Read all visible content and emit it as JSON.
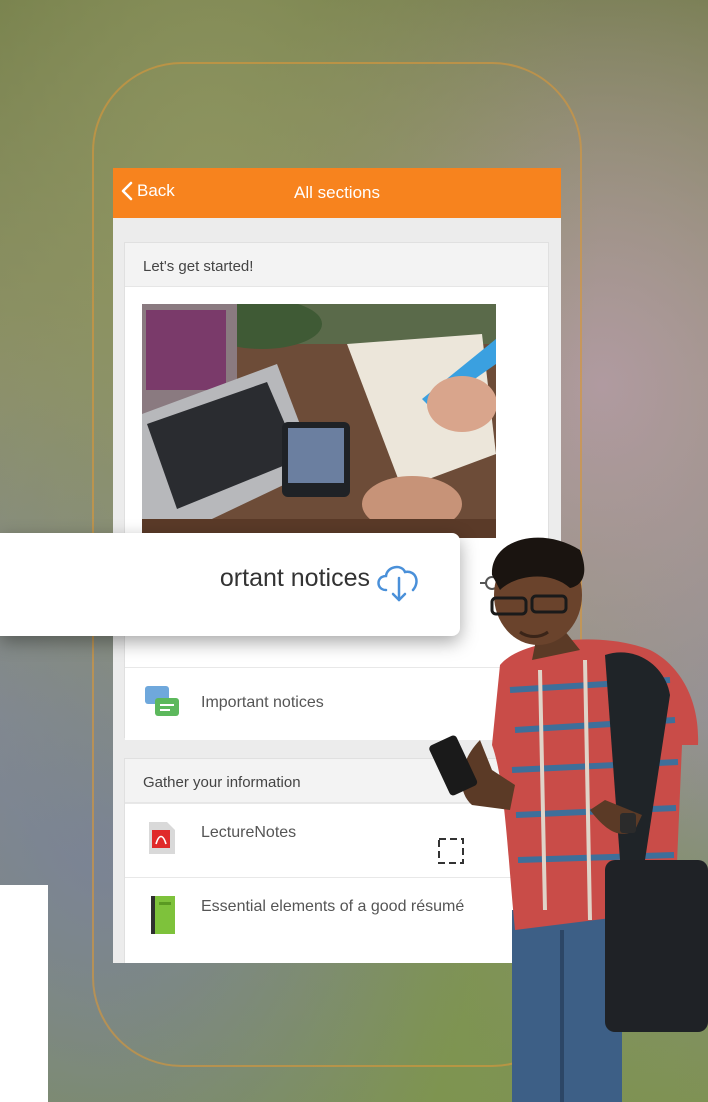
{
  "header": {
    "back_label": "Back",
    "title": "All sections"
  },
  "sections": [
    {
      "title": "Let's get started!",
      "items": [
        {
          "label": "Important notices",
          "icon": "chat-bubbles-icon"
        }
      ]
    },
    {
      "title": "Gather your information",
      "items": [
        {
          "label": "LectureNotes",
          "icon": "pdf-file-icon"
        },
        {
          "label": "Essential elements of a good résumé",
          "icon": "book-icon"
        }
      ]
    }
  ],
  "floating_card": {
    "label": "Important notices",
    "visible_label": "ortant notices",
    "icon": "cloud-download-icon"
  },
  "colors": {
    "accent": "#f7831e",
    "outline": "#d6963c",
    "cloud": "#4a90d9"
  }
}
